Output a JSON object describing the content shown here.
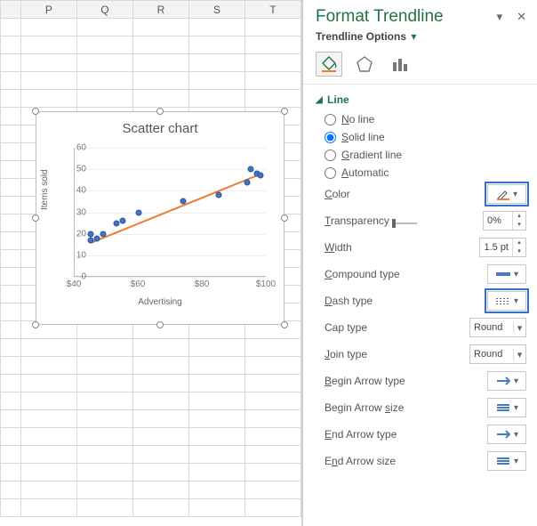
{
  "sheet": {
    "columns": [
      "P",
      "Q",
      "R",
      "S",
      "T"
    ]
  },
  "pane": {
    "title": "Format Trendline",
    "subheader": "Trendline Options",
    "section": "Line",
    "radios": {
      "no_line": {
        "text": "No line",
        "underline_first": "N"
      },
      "solid": {
        "text": "Solid line",
        "underline_first": "S"
      },
      "gradient": {
        "text": "Gradient line",
        "underline_first": "G"
      },
      "automatic": {
        "text": "Automatic",
        "underline_first": "A"
      }
    },
    "selected_radio": "solid",
    "props": {
      "color": {
        "label": "Color",
        "underline": "C"
      },
      "transparency": {
        "label": "Transparency",
        "underline": "T",
        "value": "0%"
      },
      "width": {
        "label": "Width",
        "underline": "W",
        "value": "1.5 pt"
      },
      "compound": {
        "label": "Compound type",
        "underline": "C"
      },
      "dash": {
        "label": "Dash type",
        "underline": "D"
      },
      "cap": {
        "label": "Cap type",
        "value": "Round"
      },
      "join": {
        "label": "Join type",
        "underline": "J",
        "value": "Round"
      },
      "begin_arrow_t": {
        "label": "Begin Arrow type",
        "underline": "B"
      },
      "begin_arrow_s": {
        "label": "Begin Arrow size",
        "underline": "s"
      },
      "end_arrow_t": {
        "label": "End Arrow type",
        "underline": "E"
      },
      "end_arrow_s": {
        "label": "End Arrow size",
        "underline": "n"
      }
    }
  },
  "chart_data": {
    "type": "scatter",
    "title": "Scatter chart",
    "xlabel": "Advertising",
    "ylabel": "Items sold",
    "xlim": [
      40,
      100
    ],
    "ylim": [
      0,
      60
    ],
    "xticks": [
      "$40",
      "$60",
      "$80",
      "$100"
    ],
    "yticks": [
      0,
      10,
      20,
      30,
      40,
      50,
      60
    ],
    "points": [
      {
        "x": 45,
        "y": 17
      },
      {
        "x": 45,
        "y": 20
      },
      {
        "x": 47,
        "y": 18
      },
      {
        "x": 49,
        "y": 20
      },
      {
        "x": 53,
        "y": 25
      },
      {
        "x": 55,
        "y": 26
      },
      {
        "x": 60,
        "y": 30
      },
      {
        "x": 74,
        "y": 35
      },
      {
        "x": 85,
        "y": 38
      },
      {
        "x": 94,
        "y": 44
      },
      {
        "x": 95,
        "y": 50
      },
      {
        "x": 97,
        "y": 48
      },
      {
        "x": 98,
        "y": 47
      }
    ],
    "trendline": {
      "x1": 45,
      "y1": 16,
      "x2": 98,
      "y2": 48,
      "color": "#ED7D31"
    }
  }
}
